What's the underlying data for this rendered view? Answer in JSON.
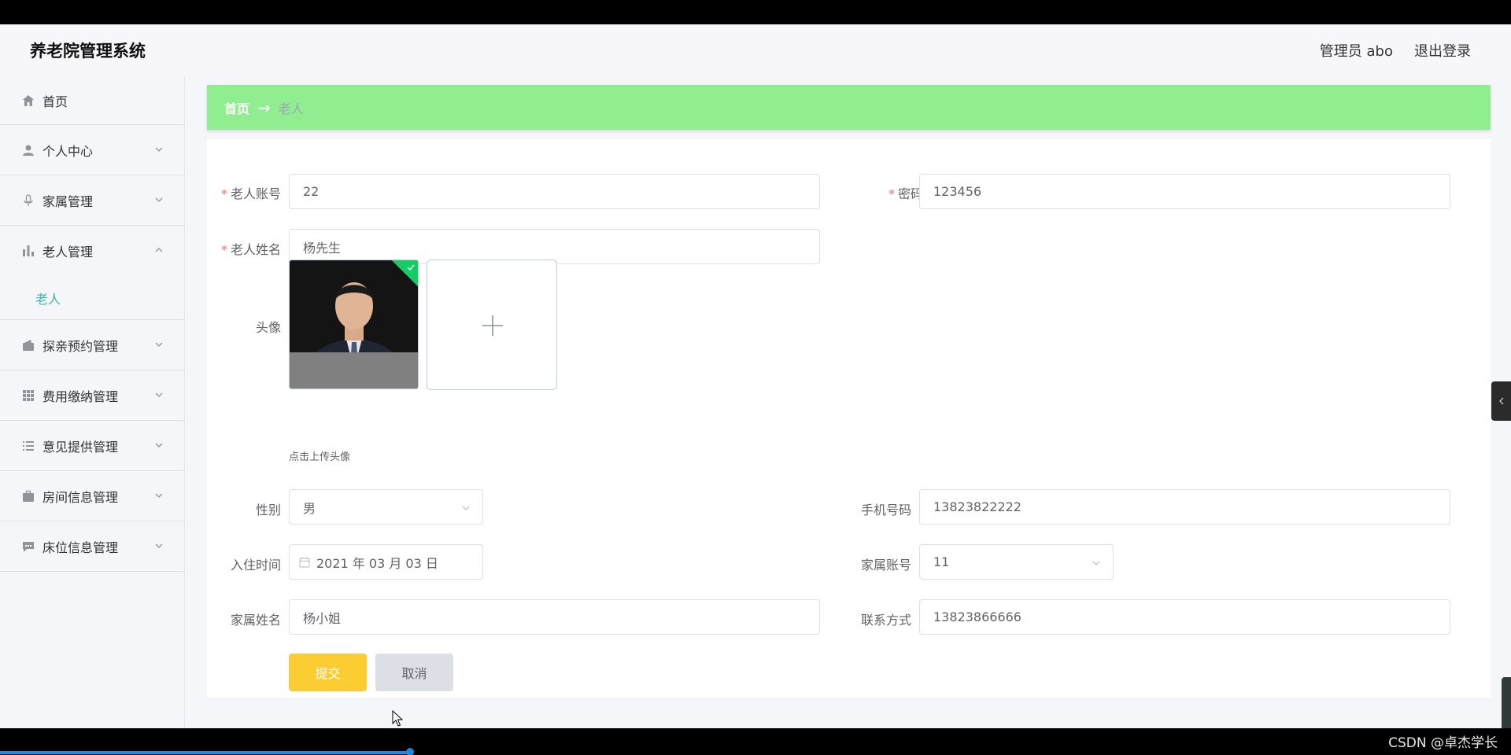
{
  "header": {
    "app_title": "养老院管理系统",
    "user_label": "管理员 abo",
    "logout_label": "退出登录"
  },
  "sidebar": {
    "items": [
      {
        "label": "首页",
        "icon": "home-icon"
      },
      {
        "label": "个人中心",
        "icon": "user-icon",
        "expandable": true
      },
      {
        "label": "家属管理",
        "icon": "microphone-icon",
        "expandable": true
      },
      {
        "label": "老人管理",
        "icon": "bar-chart-icon",
        "expandable": true,
        "expanded": true,
        "children": [
          {
            "label": "老人",
            "active": true
          }
        ]
      },
      {
        "label": "探亲预约管理",
        "icon": "wallet-icon",
        "expandable": true
      },
      {
        "label": "费用缴纳管理",
        "icon": "grid-icon",
        "expandable": true
      },
      {
        "label": "意见提供管理",
        "icon": "list-icon",
        "expandable": true
      },
      {
        "label": "房间信息管理",
        "icon": "briefcase-icon",
        "expandable": true
      },
      {
        "label": "床位信息管理",
        "icon": "chat-icon",
        "expandable": true
      }
    ],
    "active_color": "#3cb7a7"
  },
  "breadcrumb": {
    "home": "首页",
    "separator": "→",
    "current": "老人",
    "background": "#90ee90"
  },
  "form": {
    "account_label": "老人账号",
    "account_value": "22",
    "password_label": "密码",
    "password_value": "123456",
    "name_label": "老人姓名",
    "name_value": "杨先生",
    "avatar_label": "头像",
    "upload_tip": "点击上传头像",
    "gender_label": "性别",
    "gender_value": "男",
    "phone_label": "手机号码",
    "phone_value": "13823822222",
    "checkin_label": "入住时间",
    "checkin_value": "2021 年 03 月 03 日",
    "family_account_label": "家属账号",
    "family_account_value": "11",
    "family_name_label": "家属姓名",
    "family_name_value": "杨小姐",
    "contact_label": "联系方式",
    "contact_value": "13823866666",
    "submit_label": "提交",
    "cancel_label": "取消",
    "submit_color": "#fccc33",
    "required_color": "#f56c6c"
  },
  "footer": {
    "watermark": "CSDN @卓杰学长"
  }
}
